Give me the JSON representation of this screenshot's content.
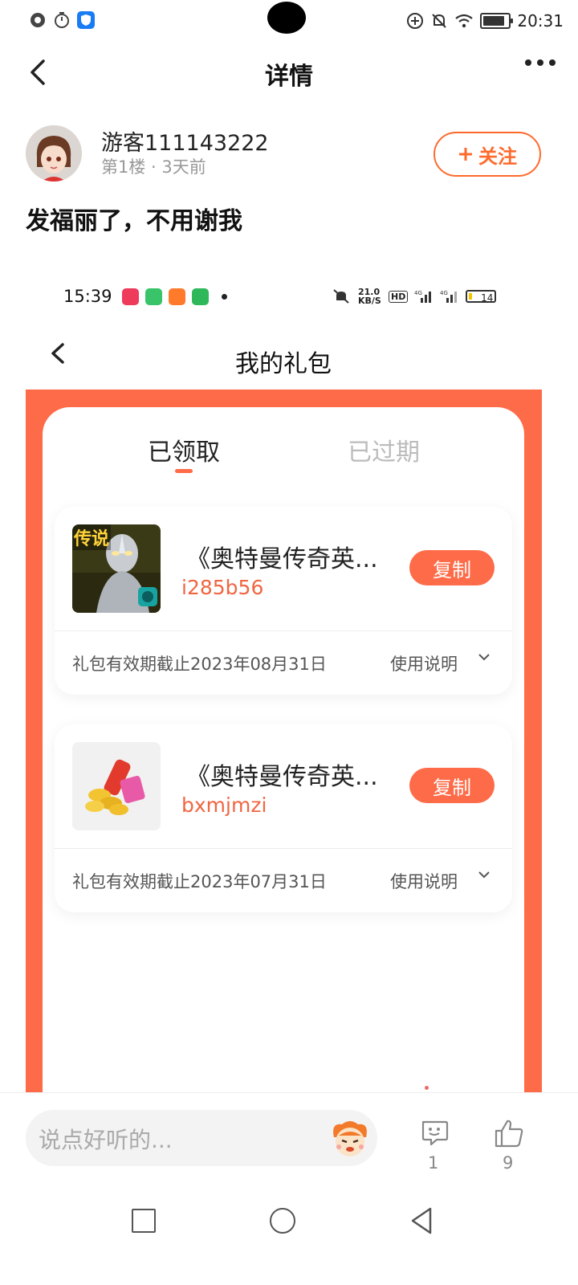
{
  "status_bar": {
    "time": "20:31"
  },
  "header": {
    "title": "详情"
  },
  "post": {
    "username": "游客111143222",
    "meta": "第1楼 · 3天前",
    "follow_label": "关注",
    "text": "发福丽了，不用谢我"
  },
  "embedded": {
    "status_time": "15:39",
    "net_speed": "21.0 KB/S",
    "battery": "14",
    "title": "我的礼包",
    "tabs": [
      {
        "label": "已领取",
        "active": true
      },
      {
        "label": "已过期",
        "active": false
      }
    ],
    "gifts": [
      {
        "name": "《奥特曼传奇英...",
        "code": "i285b56",
        "copy_label": "复制",
        "expiry": "礼包有效期截止2023年08月31日",
        "howto": "使用说明",
        "thumb_text": "传说"
      },
      {
        "name": "《奥特曼传奇英...",
        "code": "bxmjmzi",
        "copy_label": "复制",
        "expiry": "礼包有效期截止2023年07月31日",
        "howto": "使用说明"
      }
    ]
  },
  "bottom": {
    "comment_placeholder": "说点好听的...",
    "comment_count": "1",
    "like_count": "9"
  },
  "colors": {
    "accent": "#fe6b48",
    "follow": "#ff6a2c",
    "code": "#f06642"
  }
}
